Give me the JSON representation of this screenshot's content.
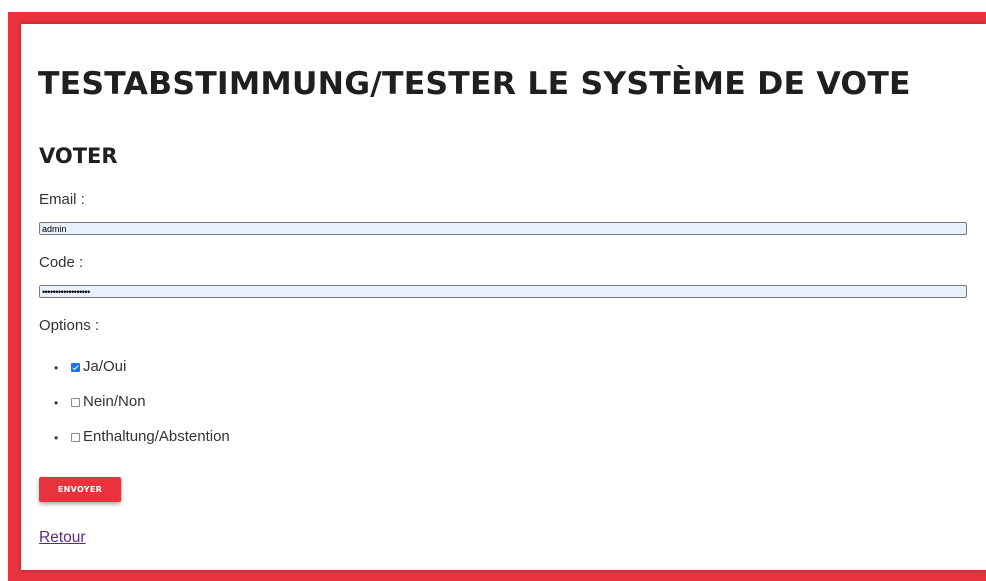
{
  "page": {
    "title": "TESTABSTIMMUNG/TESTER LE SYSTÈME DE VOTE",
    "section_title": "VOTER"
  },
  "form": {
    "email_label": "Email :",
    "email_value": "admin",
    "code_label": "Code :",
    "code_value": "••••••••••••••••••",
    "options_label": "Options :",
    "options": [
      {
        "label": "Ja/Oui",
        "checked": true
      },
      {
        "label": "Nein/Non",
        "checked": false
      },
      {
        "label": "Enthaltung/Abstention",
        "checked": false
      }
    ],
    "submit_label": "ENVOYER"
  },
  "footer": {
    "back_link": "Retour"
  },
  "colors": {
    "accent": "#e8323c",
    "link": "#5a2d82",
    "checkbox_checked": "#1a73e8",
    "autofill_bg": "#e8f0fe"
  }
}
